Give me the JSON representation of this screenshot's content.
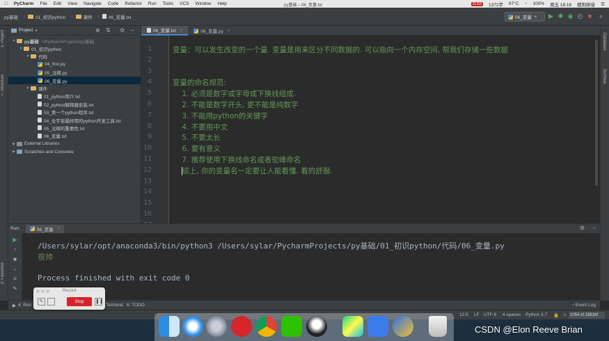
{
  "menubar": {
    "app": "PyCharm",
    "items": [
      "File",
      "Edit",
      "View",
      "Navigate",
      "Code",
      "Refactor",
      "Run",
      "Tools",
      "VCS",
      "Window",
      "Help"
    ],
    "window_title": "py基础 – 06_变量.txt",
    "status": {
      "time_small": "11:52",
      "net": "1372字",
      "temp": "67°C",
      "battery": "100%",
      "datetime": "周五 18:16",
      "input_method": "搜狗拼音"
    }
  },
  "navbar": {
    "crumbs": [
      "py基础",
      "01_初识python",
      "课件",
      "06_变量.txt"
    ],
    "run_config": "06_变量"
  },
  "left_strip": {
    "project_tab": "1: Project",
    "structure_tab": "7: Structure",
    "favorites_tab": "2: Favorites"
  },
  "right_strip": {
    "database_tab": "Database",
    "sciview_tab": "SciView"
  },
  "project": {
    "header": "Project",
    "tree": [
      {
        "label": "py基础",
        "extra": "~/PycharmProjects/py基础",
        "kind": "folder",
        "arrow": "▼",
        "bold": true
      },
      {
        "label": "01_初识python",
        "kind": "folder",
        "arrow": "▼"
      },
      {
        "label": "代码",
        "kind": "folder",
        "arrow": "▼"
      },
      {
        "label": "04_first.py",
        "kind": "py"
      },
      {
        "label": "05_注释.py",
        "kind": "py"
      },
      {
        "label": "06_变量.py",
        "kind": "py",
        "selected": true
      },
      {
        "label": "课件",
        "kind": "folder",
        "arrow": "▼"
      },
      {
        "label": "01_python简介.txt",
        "kind": "txt"
      },
      {
        "label": "02_python解释器安装.txt",
        "kind": "txt"
      },
      {
        "label": "03_第一个python程序.txt",
        "kind": "txt"
      },
      {
        "label": "04_全宇宙最好用的python开发工具.txt",
        "kind": "txt"
      },
      {
        "label": "05_注释的重要性.txt",
        "kind": "txt"
      },
      {
        "label": "06_变量.txt",
        "kind": "txt"
      },
      {
        "label": "External Libraries",
        "kind": "lib",
        "arrow": "▶"
      },
      {
        "label": "Scratches and Consoles",
        "kind": "scratch",
        "arrow": "▶"
      }
    ]
  },
  "editor": {
    "tabs": [
      {
        "label": "06_变量.txt",
        "active": true
      },
      {
        "label": "06_变量.py",
        "active": false
      }
    ],
    "line_numbers": [
      "1",
      "2",
      "3",
      "4",
      "5",
      "6",
      "7",
      "8",
      "9",
      "10",
      "11",
      "12",
      "13",
      "14",
      "15",
      "16",
      "17"
    ],
    "lines": [
      "变量：可以发生改变的一个量. 变量是用来区分不同数据的. 可以指向一个内存空间, 帮我们存储一些数据",
      "",
      "",
      "变量的命名规范:",
      "    1. 必须是数字或字母或下换线组成.",
      "    2. 不能是数字开头, 更不能是纯数字",
      "    3. 不能用python的关键字",
      "    4. 不要用中文",
      "    5. 不要太长",
      "    6. 要有意义",
      "    7. 推荐使用下换线命名或者驼峰命名",
      "    综上, 你的变量名一定要让人能看懂. 看的舒服.",
      "",
      "",
      "",
      "",
      ""
    ],
    "current_line": 12
  },
  "run": {
    "label": "Run:",
    "tab": "06_变量",
    "output": [
      "/Users/sylar/opt/anaconda3/bin/python3 /Users/sylar/PycharmProjects/py基础/01_初识python/代码/06_变量.py",
      "很帅",
      "",
      "Process finished with exit code 0"
    ]
  },
  "bottom_tools": {
    "run": "4: Run",
    "terminal": "Terminal",
    "todo": "6: TODO",
    "event_log": "Event Log"
  },
  "statusbar": {
    "position": "12:5",
    "line_sep": "LF",
    "encoding": "UTF-8",
    "indent": "4 spaces",
    "interpreter": "Python 3.7",
    "memory": "1054 of 1981M"
  },
  "record": {
    "title": "Record",
    "stop": "Stop"
  },
  "dock": {
    "apps": [
      "finder",
      "safari",
      "launchpad",
      "netease-music",
      "chrome",
      "wechat",
      "qq",
      "pycharm",
      "lark",
      "thunder",
      "trash"
    ]
  },
  "watermark": "CSDN @Elon Reeve Brian",
  "colors": {
    "string_green": "#629755",
    "editor_bg": "#2b2b2b",
    "panel_bg": "#3c3f41",
    "accent_blue": "#4a88c7",
    "stop_red": "#d4242a"
  }
}
